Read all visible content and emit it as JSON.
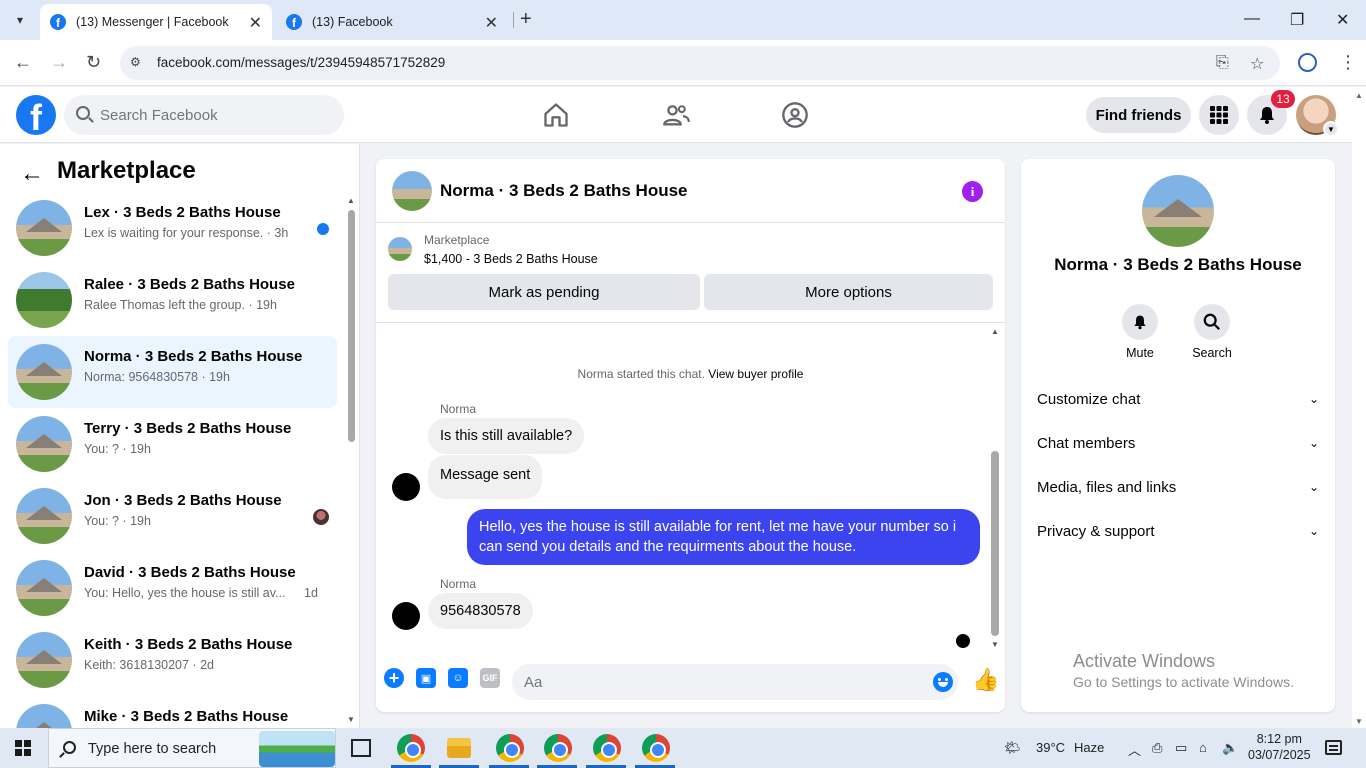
{
  "browser": {
    "tabs": [
      {
        "title": "(13) Messenger | Facebook",
        "active": true
      },
      {
        "title": "(13) Facebook",
        "active": false
      }
    ],
    "url": "facebook.com/messages/t/23945948571752829"
  },
  "header": {
    "search_placeholder": "Search Facebook",
    "find_friends_label": "Find friends",
    "notifications_count": "13"
  },
  "sidebar": {
    "title": "Marketplace",
    "conversations": [
      {
        "name": "Lex · 3 Beds 2 Baths House",
        "snippet": "Lex is waiting for your response. · 3h",
        "unread": true
      },
      {
        "name": "Ralee · 3 Beds 2 Baths House",
        "snippet": "Ralee Thomas left the group. · 19h"
      },
      {
        "name": "Norma · 3 Beds 2 Baths House",
        "snippet": "Norma: 9564830578 · 19h",
        "active": true
      },
      {
        "name": "Terry · 3 Beds 2 Baths House",
        "snippet": "You: ? · 19h"
      },
      {
        "name": "Jon · 3 Beds 2 Baths House",
        "snippet": "You: ? · 19h"
      },
      {
        "name": "David · 3 Beds 2 Baths House",
        "snippet": "You: Hello, yes the house is still av...",
        "time": "1d"
      },
      {
        "name": "Keith · 3 Beds 2 Baths House",
        "snippet": "Keith: 3618130207 · 2d"
      },
      {
        "name": "Mike · 3 Beds 2 Baths House",
        "snippet": ""
      }
    ]
  },
  "chat": {
    "title": "Norma · 3 Beds 2 Baths House",
    "listing": {
      "source": "Marketplace",
      "price_title": "$1,400 - 3 Beds 2 Baths House",
      "mark_pending_label": "Mark as pending",
      "more_options_label": "More options"
    },
    "notice_text": "Norma started this chat.",
    "notice_link": "View buyer profile",
    "messages": [
      {
        "sender": "Norma",
        "text": "Is this still available?"
      },
      {
        "text": "Message sent"
      },
      {
        "text": "Hello, yes the house is still available for rent, let me have your number so i can send you details and the requirments about the house."
      },
      {
        "sender": "Norma",
        "text": "9564830578"
      }
    ],
    "composer_placeholder": "Aa",
    "gif_label": "GIF"
  },
  "info_panel": {
    "name": "Norma · 3 Beds 2 Baths House",
    "mute_label": "Mute",
    "search_label": "Search",
    "sections": [
      "Customize chat",
      "Chat members",
      "Media, files and links",
      "Privacy & support"
    ],
    "watermark_line1": "Activate Windows",
    "watermark_line2": "Go to Settings to activate Windows."
  },
  "taskbar": {
    "search_placeholder": "Type here to search",
    "weather_temp": "39°C",
    "weather_desc": "Haze",
    "time": "8:12 pm",
    "date": "03/07/2025"
  }
}
